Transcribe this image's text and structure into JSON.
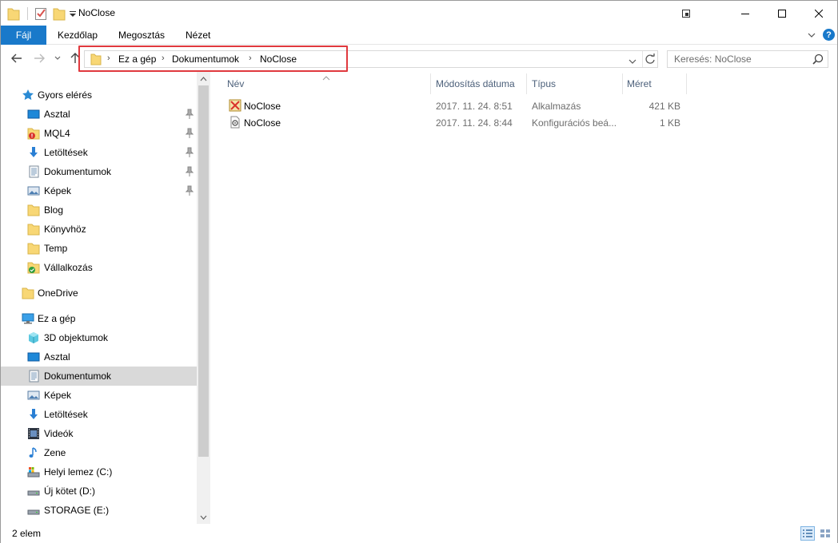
{
  "window": {
    "title": "NoClose"
  },
  "ribbon": {
    "tabs": [
      "Fájl",
      "Kezdőlap",
      "Megosztás",
      "Nézet"
    ]
  },
  "address": {
    "crumbs": [
      "Ez a gép",
      "Dokumentumok",
      "NoClose"
    ],
    "search_placeholder": "Keresés: NoClose"
  },
  "sidebar": {
    "quick_access": {
      "label": "Gyors elérés",
      "items": [
        {
          "label": "Asztal",
          "icon": "desktop-icon",
          "pinned": true
        },
        {
          "label": "MQL4",
          "icon": "warning-folder-icon",
          "pinned": true
        },
        {
          "label": "Letöltések",
          "icon": "download-icon",
          "pinned": true
        },
        {
          "label": "Dokumentumok",
          "icon": "documents-icon",
          "pinned": true
        },
        {
          "label": "Képek",
          "icon": "pictures-icon",
          "pinned": true
        },
        {
          "label": "Blog",
          "icon": "folder-icon",
          "pinned": false
        },
        {
          "label": "Könyvhöz",
          "icon": "folder-icon",
          "pinned": false
        },
        {
          "label": "Temp",
          "icon": "folder-icon",
          "pinned": false
        },
        {
          "label": "Vállalkozás",
          "icon": "synced-folder-icon",
          "pinned": false
        }
      ]
    },
    "onedrive": {
      "label": "OneDrive"
    },
    "this_pc": {
      "label": "Ez a gép",
      "items": [
        {
          "label": "3D objektumok",
          "icon": "cube-icon"
        },
        {
          "label": "Asztal",
          "icon": "desktop-icon"
        },
        {
          "label": "Dokumentumok",
          "icon": "documents-icon",
          "selected": true
        },
        {
          "label": "Képek",
          "icon": "pictures-icon"
        },
        {
          "label": "Letöltések",
          "icon": "download-icon"
        },
        {
          "label": "Videók",
          "icon": "video-icon"
        },
        {
          "label": "Zene",
          "icon": "music-icon"
        },
        {
          "label": "Helyi lemez (C:)",
          "icon": "system-drive-icon"
        },
        {
          "label": "Új kötet (D:)",
          "icon": "drive-icon"
        },
        {
          "label": "STORAGE (E:)",
          "icon": "drive-icon"
        }
      ]
    }
  },
  "files": {
    "columns": [
      "Név",
      "Módosítás dátuma",
      "Típus",
      "Méret"
    ],
    "rows": [
      {
        "name": "NoClose",
        "modified": "2017. 11. 24. 8:51",
        "type": "Alkalmazás",
        "size": "421 KB",
        "icon": "application-icon"
      },
      {
        "name": "NoClose",
        "modified": "2017. 11. 24. 8:44",
        "type": "Konfigurációs beá...",
        "size": "1 KB",
        "icon": "config-file-icon"
      }
    ]
  },
  "status": {
    "count": "2 elem"
  },
  "colors": {
    "accent": "#1979ca",
    "highlight": "#e0393e",
    "selected": "#d9d9d9"
  }
}
